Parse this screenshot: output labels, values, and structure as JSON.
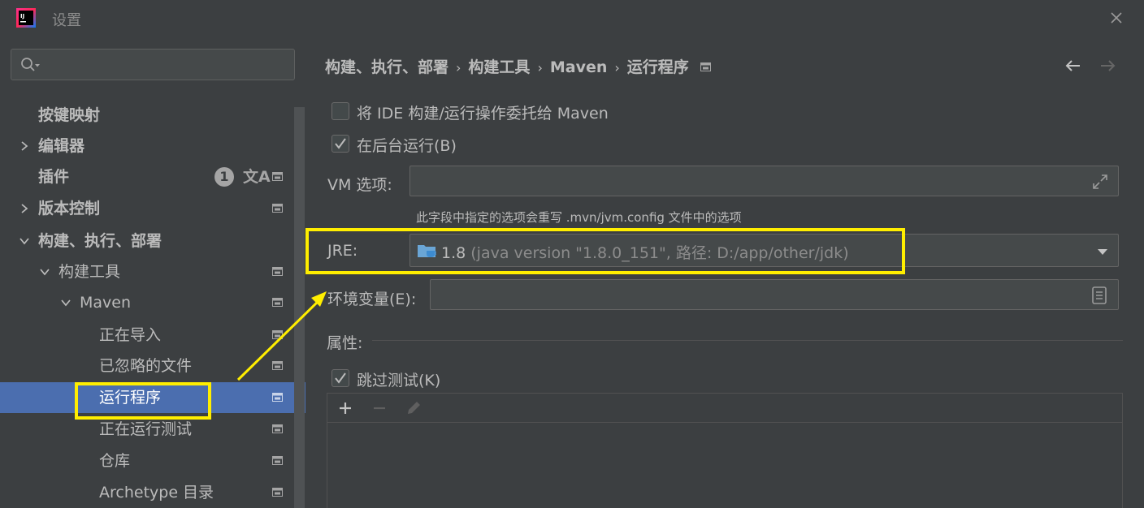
{
  "window": {
    "title": "设置"
  },
  "sidebar": {
    "search_placeholder": "",
    "items": [
      {
        "label": "按键映射"
      },
      {
        "label": "编辑器"
      },
      {
        "label": "插件",
        "badge": "1"
      },
      {
        "label": "版本控制"
      },
      {
        "label": "构建、执行、部署"
      },
      {
        "label": "构建工具"
      },
      {
        "label": "Maven"
      },
      {
        "label": "正在导入"
      },
      {
        "label": "已忽略的文件"
      },
      {
        "label": "运行程序"
      },
      {
        "label": "正在运行测试"
      },
      {
        "label": "仓库"
      },
      {
        "label": "Archetype 目录"
      }
    ]
  },
  "breadcrumb": [
    "构建、执行、部署",
    "构建工具",
    "Maven",
    "运行程序"
  ],
  "main": {
    "delegate_label": "将 IDE 构建/运行操作委托给 Maven",
    "background_label": "在后台运行(B)",
    "vm_label": "VM 选项:",
    "vm_value": "",
    "vm_hint": "此字段中指定的选项会重写 .mvn/jvm.config 文件中的选项",
    "jre_label": "JRE:",
    "jre_version": "1.8",
    "jre_detail": " (java version \"1.8.0_151\", 路径: D:/app/other/jdk)",
    "env_label": "环境变量(E):",
    "env_value": "",
    "properties_label": "属性:",
    "skip_tests_label": "跳过测试(K)"
  },
  "colors": {
    "background": "#3c3f41",
    "selection": "#4b6eaf",
    "annotation": "#ffee00"
  }
}
